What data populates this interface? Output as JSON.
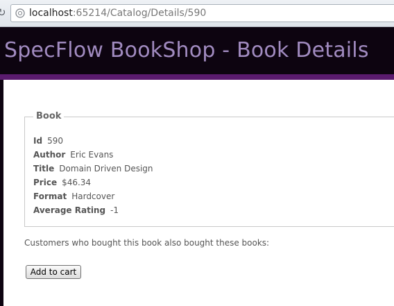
{
  "browser": {
    "url_host": "localhost",
    "url_path": ":65214/Catalog/Details/590",
    "reload_icon": "reload-icon",
    "globe_icon": "globe-icon"
  },
  "header": {
    "title": "SpecFlow BookShop - Book Details",
    "title_color": "#a18bc0",
    "background_color": "#0d0410",
    "stripe_color": "#5a1b6e"
  },
  "book": {
    "legend": "Book",
    "details": [
      {
        "label": "Id",
        "value": "590"
      },
      {
        "label": "Author",
        "value": "Eric Evans"
      },
      {
        "label": "Title",
        "value": "Domain Driven Design"
      },
      {
        "label": "Price",
        "value": "$46.34"
      },
      {
        "label": "Format",
        "value": "Hardcover"
      },
      {
        "label": "Average Rating",
        "value": "-1"
      }
    ]
  },
  "also_bought_text": "Customers who bought this book also bought these books:",
  "add_to_cart_label": "Add to cart"
}
